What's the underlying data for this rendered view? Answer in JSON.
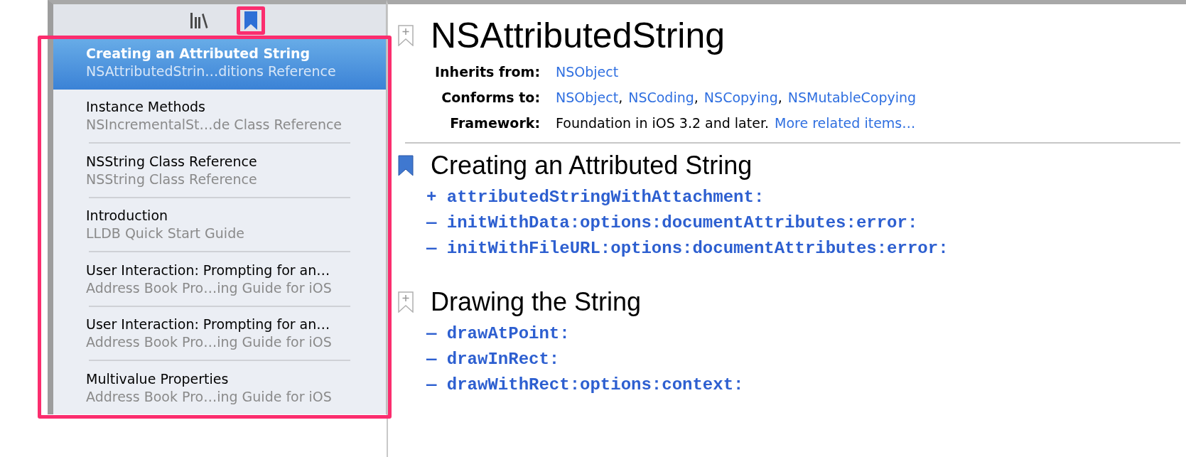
{
  "sidebar": {
    "list_highlighted": true,
    "tabs": [
      {
        "kind": "library",
        "selected": false,
        "highlighted": false
      },
      {
        "kind": "bookmarks",
        "selected": true,
        "highlighted": true
      }
    ],
    "items": [
      {
        "title": "Creating an Attributed String",
        "subtitle": "NSAttributedStrin…ditions Reference",
        "selected": true
      },
      {
        "title": "Instance Methods",
        "subtitle": "NSIncrementalSt…de Class Reference",
        "selected": false
      },
      {
        "title": "NSString Class Reference",
        "subtitle": "NSString Class Reference",
        "selected": false
      },
      {
        "title": "Introduction",
        "subtitle": "LLDB Quick Start Guide",
        "selected": false
      },
      {
        "title": "User Interaction: Prompting for an…",
        "subtitle": "Address Book Pro…ing Guide for iOS",
        "selected": false
      },
      {
        "title": "User Interaction: Prompting for an…",
        "subtitle": "Address Book Pro…ing Guide for iOS",
        "selected": false
      },
      {
        "title": "Multivalue Properties",
        "subtitle": "Address Book Pro…ing Guide for iOS",
        "selected": false
      }
    ]
  },
  "document": {
    "title": "NSAttributedString",
    "bookmarked": false,
    "meta": [
      {
        "label": "Inherits from:",
        "parts": [
          {
            "text": "NSObject",
            "link": true
          }
        ]
      },
      {
        "label": "Conforms to:",
        "parts": [
          {
            "text": "NSObject",
            "link": true
          },
          {
            "text": ",",
            "link": false
          },
          {
            "text": "NSCoding",
            "link": true
          },
          {
            "text": ",",
            "link": false
          },
          {
            "text": "NSCopying",
            "link": true
          },
          {
            "text": ",",
            "link": false
          },
          {
            "text": "NSMutableCopying",
            "link": true
          }
        ]
      },
      {
        "label": "Framework:",
        "parts": [
          {
            "text": "Foundation in iOS 3.2 and later.",
            "link": false
          },
          {
            "text": "More related items…",
            "link": true
          }
        ]
      }
    ],
    "sections": [
      {
        "heading": "Creating an Attributed String",
        "bookmarked": true,
        "methods": [
          {
            "prefix": "+",
            "name": "attributedStringWithAttachment:"
          },
          {
            "prefix": "—",
            "name": "initWithData:options:documentAttributes:error:"
          },
          {
            "prefix": "—",
            "name": "initWithFileURL:options:documentAttributes:error:"
          }
        ]
      },
      {
        "heading": "Drawing the String",
        "bookmarked": false,
        "methods": [
          {
            "prefix": "—",
            "name": "drawAtPoint:"
          },
          {
            "prefix": "—",
            "name": "drawInRect:"
          },
          {
            "prefix": "—",
            "name": "drawWithRect:options:context:"
          }
        ]
      }
    ]
  }
}
